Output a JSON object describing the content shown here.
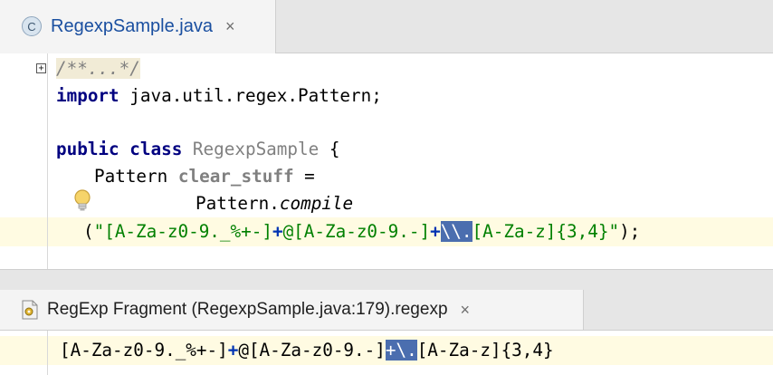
{
  "editor_tab": {
    "icon_letter": "C",
    "title": "RegexpSample.java",
    "close": "×"
  },
  "fold_marker": "+",
  "code": {
    "line1_doc": "/**...*/",
    "line2_kw": "import",
    "line2_rest": " java.util.regex.Pattern;",
    "line4_kw1": "public",
    "line4_kw2": "class",
    "line4_name": "RegexpSample",
    "line4_brace": " {",
    "line5_type": "Pattern",
    "line5_field": "clear_stuff",
    "line5_eq": " =",
    "line6_class": "Pattern.",
    "line6_method": "compile",
    "line7_open": "(",
    "line7_q1": "\"",
    "line7_part1": "[A-Za-z0-9._%+-]",
    "line7_plus1": "+",
    "line7_part2": "@[A-Za-z0-9.-]",
    "line7_plus2": "+",
    "line7_sel": "\\\\.",
    "line7_part3": "[A-Za-z]{3,4}",
    "line7_q2": "\"",
    "line7_close": ");"
  },
  "fragment_tab": {
    "title": "RegExp Fragment (RegexpSample.java:179).regexp",
    "close": "×"
  },
  "fragment": {
    "part1": "[A-Za-z0-9._%+-]",
    "plus1": "+",
    "part2": "@[A-Za-z0-9.-]",
    "plus2": "+",
    "sel": "\\.",
    "part3": "[A-Za-z]{3,4}"
  },
  "icons": {
    "class_icon": "class-icon",
    "bulb_icon": "lightbulb-icon",
    "regexp_icon": "regexp-file-icon"
  }
}
